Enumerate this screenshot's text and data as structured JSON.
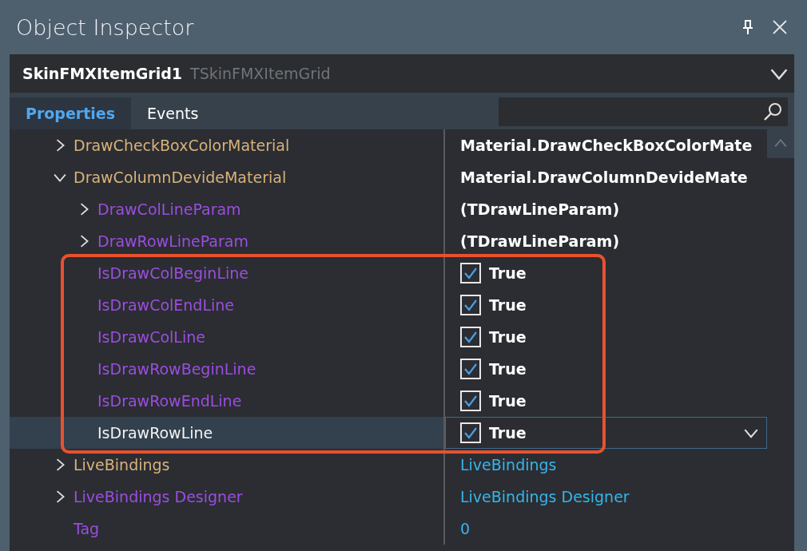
{
  "window": {
    "title": "Object Inspector"
  },
  "object_selector": {
    "name": "SkinFMXItemGrid1",
    "type": "TSkinFMXItemGrid"
  },
  "tabs": [
    {
      "label": "Properties",
      "selected": true
    },
    {
      "label": "Events",
      "selected": false
    }
  ],
  "properties": [
    {
      "name": "DrawCheckBoxColorMaterial",
      "kind": "object",
      "expanded": false,
      "selected": false,
      "highlighted": false,
      "value": {
        "kind": "text",
        "text": "Material.DrawCheckBoxColorMate"
      }
    },
    {
      "name": "DrawColumnDevideMaterial",
      "kind": "object",
      "expanded": true,
      "selected": false,
      "highlighted": false,
      "value": {
        "kind": "text",
        "text": "Material.DrawColumnDevideMate"
      },
      "children": [
        {
          "name": "DrawColLineParam",
          "kind": "property",
          "expanded": false,
          "selected": false,
          "highlighted": false,
          "value": {
            "kind": "text",
            "text": "(TDrawLineParam)"
          }
        },
        {
          "name": "DrawRowLineParam",
          "kind": "property",
          "expanded": false,
          "selected": false,
          "highlighted": false,
          "value": {
            "kind": "text",
            "text": "(TDrawLineParam)"
          }
        },
        {
          "name": "IsDrawColBeginLine",
          "kind": "property",
          "selected": false,
          "highlighted": true,
          "value": {
            "kind": "checkbox",
            "checked": true,
            "text": "True"
          }
        },
        {
          "name": "IsDrawColEndLine",
          "kind": "property",
          "selected": false,
          "highlighted": true,
          "value": {
            "kind": "checkbox",
            "checked": true,
            "text": "True"
          }
        },
        {
          "name": "IsDrawColLine",
          "kind": "property",
          "selected": false,
          "highlighted": true,
          "value": {
            "kind": "checkbox",
            "checked": true,
            "text": "True"
          }
        },
        {
          "name": "IsDrawRowBeginLine",
          "kind": "property",
          "selected": false,
          "highlighted": true,
          "value": {
            "kind": "checkbox",
            "checked": true,
            "text": "True"
          }
        },
        {
          "name": "IsDrawRowEndLine",
          "kind": "property",
          "selected": false,
          "highlighted": true,
          "value": {
            "kind": "checkbox",
            "checked": true,
            "text": "True"
          }
        },
        {
          "name": "IsDrawRowLine",
          "kind": "property",
          "selected": true,
          "highlighted": true,
          "value": {
            "kind": "checkbox",
            "checked": true,
            "text": "True"
          }
        }
      ]
    },
    {
      "name": "LiveBindings",
      "kind": "object",
      "expanded": false,
      "selected": false,
      "highlighted": false,
      "value": {
        "kind": "link",
        "text": "LiveBindings"
      }
    },
    {
      "name": "LiveBindings Designer",
      "kind": "property",
      "expanded": false,
      "selected": false,
      "highlighted": false,
      "value": {
        "kind": "link",
        "text": "LiveBindings Designer"
      }
    },
    {
      "name": "Tag",
      "kind": "property",
      "selected": false,
      "highlighted": false,
      "value": {
        "kind": "link",
        "text": "0"
      }
    }
  ]
}
